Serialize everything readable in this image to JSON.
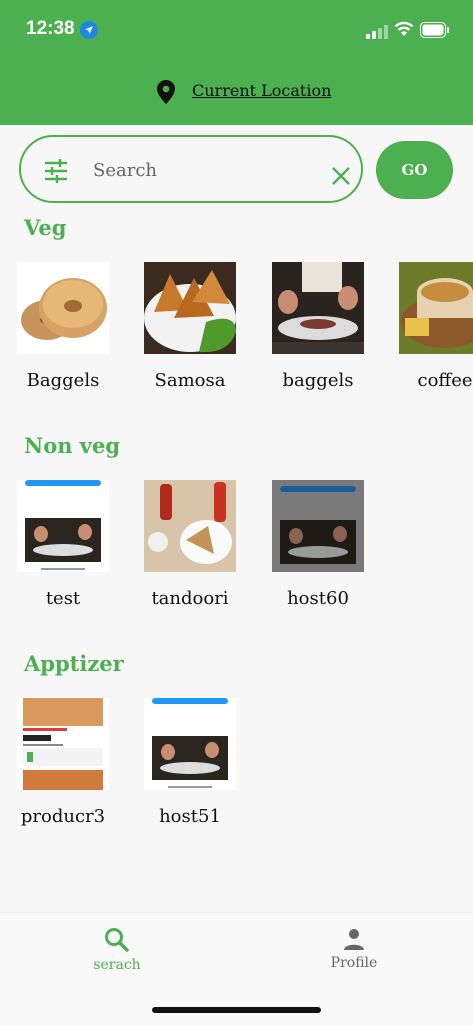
{
  "status_bar": {
    "time": "12:38"
  },
  "header": {
    "location_label": "Current Location"
  },
  "search": {
    "placeholder": "Search",
    "go_label": "GO"
  },
  "colors": {
    "accent": "#4caf50",
    "inactive": "#666666"
  },
  "sections": [
    {
      "title": "Veg",
      "items": [
        {
          "label": "Baggels",
          "image": "bagel"
        },
        {
          "label": "Samosa",
          "image": "samosa"
        },
        {
          "label": "baggels",
          "image": "plated-dish"
        },
        {
          "label": "coffee",
          "image": "coffee"
        }
      ]
    },
    {
      "title": "Non veg",
      "items": [
        {
          "label": "test",
          "image": "app-screenshot"
        },
        {
          "label": "tandoori",
          "image": "tandoori"
        },
        {
          "label": "host60",
          "image": "app-screenshot-dark"
        }
      ]
    },
    {
      "title": "Apptizer",
      "items": [
        {
          "label": "producr3",
          "image": "listing-screenshot"
        },
        {
          "label": "host51",
          "image": "app-screenshot"
        }
      ]
    }
  ],
  "tabbar": {
    "search_label": "serach",
    "profile_label": "Profile"
  }
}
